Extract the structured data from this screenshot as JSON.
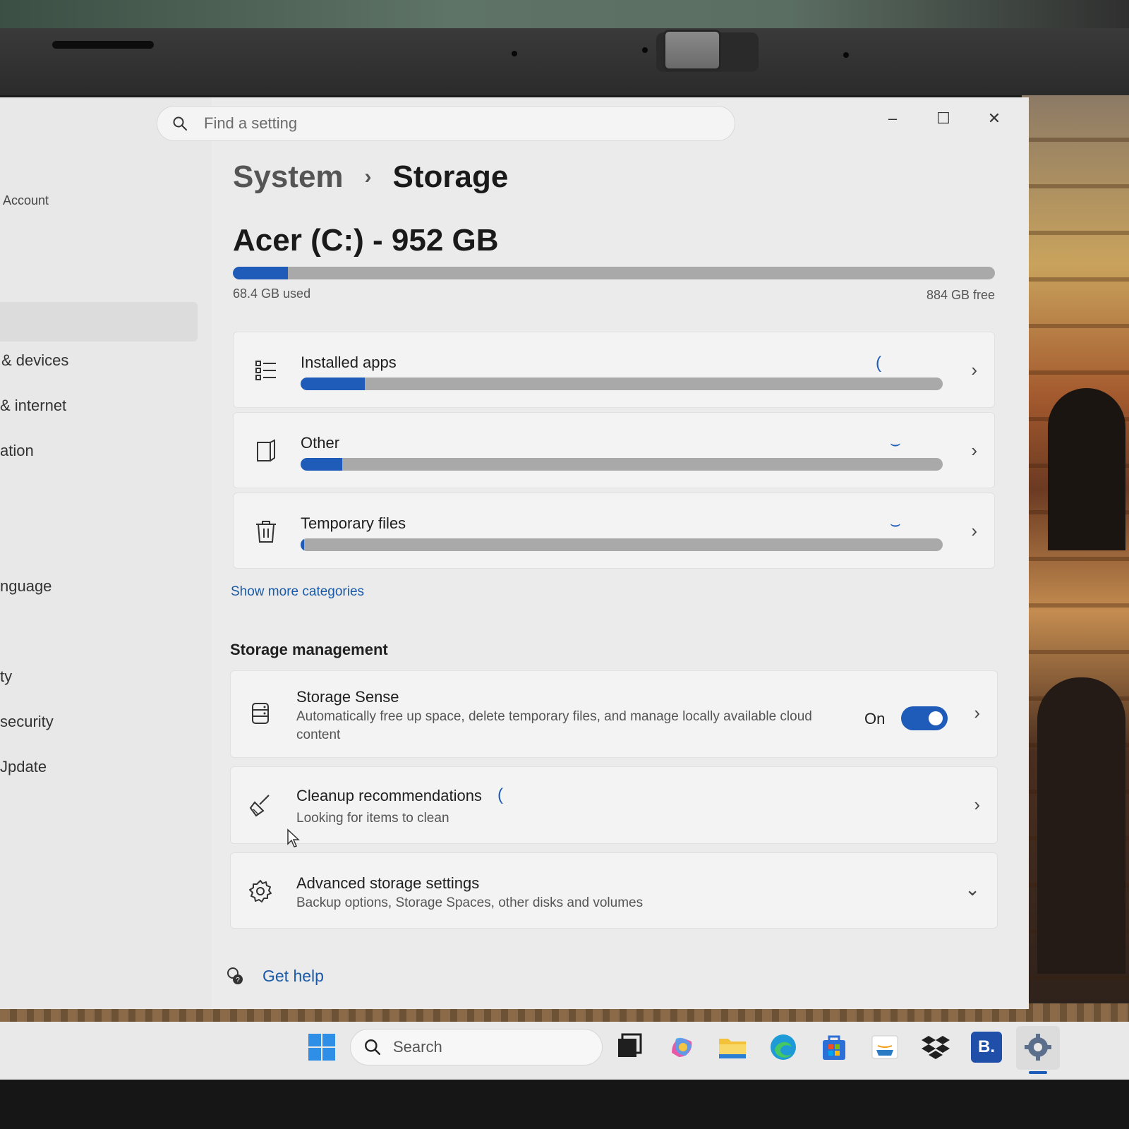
{
  "search": {
    "placeholder": "Find a setting"
  },
  "sidebar": {
    "items": [
      {
        "label": "Account"
      },
      {
        "label": "& devices"
      },
      {
        "label": "& internet"
      },
      {
        "label": "ation"
      },
      {
        "label": "nguage"
      },
      {
        "label": "ty"
      },
      {
        "label": "security"
      },
      {
        "label": "Jpdate"
      }
    ]
  },
  "window_controls": {
    "minimize": "–",
    "maximize": "☐",
    "close": "✕"
  },
  "breadcrumb": {
    "parent": "System",
    "separator": "›",
    "current": "Storage"
  },
  "drive": {
    "title": "Acer (C:) - 952 GB",
    "used_label": "68.4 GB used",
    "free_label": "884 GB free",
    "used_fraction": 0.072
  },
  "categories": [
    {
      "label": "Installed apps",
      "icon": "apps-list-icon",
      "fill_fraction": 0.1
    },
    {
      "label": "Other",
      "icon": "document-icon",
      "fill_fraction": 0.065
    },
    {
      "label": "Temporary files",
      "icon": "trash-icon",
      "fill_fraction": 0.006
    }
  ],
  "show_more_label": "Show more categories",
  "storage_management": {
    "title": "Storage management",
    "storage_sense": {
      "title": "Storage Sense",
      "description": "Automatically free up space, delete temporary files, and manage locally available cloud content",
      "state_label": "On",
      "enabled": true
    },
    "cleanup": {
      "title": "Cleanup recommendations",
      "description": "Looking for items to clean"
    },
    "advanced": {
      "title": "Advanced storage settings",
      "description": "Backup options, Storage Spaces, other disks and volumes"
    }
  },
  "get_help_label": "Get help",
  "taskbar": {
    "search_label": "Search",
    "apps": [
      "start-icon",
      "task-view-icon",
      "copilot-icon",
      "file-explorer-icon",
      "edge-icon",
      "store-icon",
      "amazon-icon",
      "dropbox-icon",
      "b-app-icon",
      "settings-icon"
    ],
    "b_app_letter": "B."
  },
  "colors": {
    "accent": "#1f5bb8",
    "bar_track": "#a9a9a9",
    "link": "#1a5aa8"
  }
}
